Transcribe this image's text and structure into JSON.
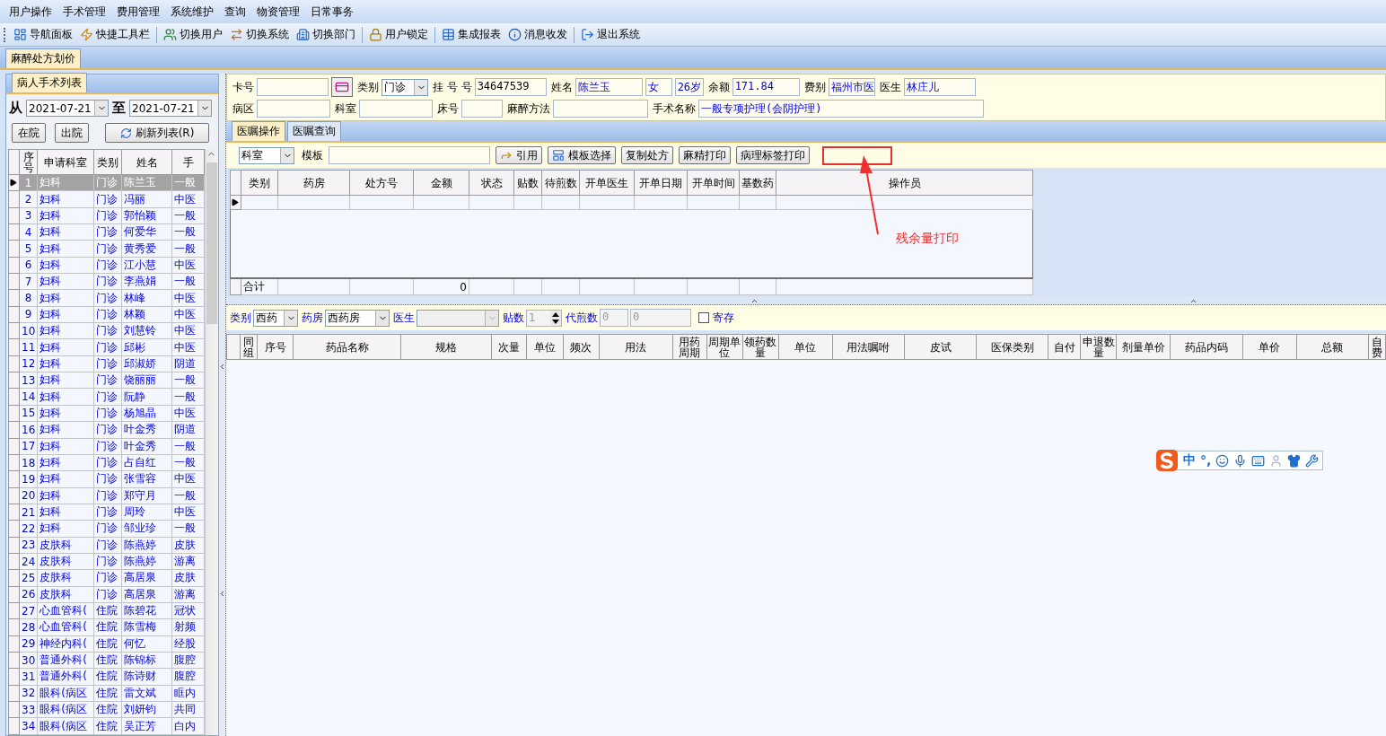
{
  "menu": [
    "用户操作",
    "手术管理",
    "费用管理",
    "系统维护",
    "查询",
    "物资管理",
    "日常事务"
  ],
  "toolbar_groups": [
    {
      "buttons": [
        {
          "label": "导航面板",
          "kind": "nav"
        },
        {
          "label": "快捷工具栏",
          "kind": "quick"
        }
      ]
    },
    {
      "buttons": [
        {
          "label": "切换用户",
          "kind": "user"
        },
        {
          "label": "切换系统",
          "kind": "system"
        },
        {
          "label": "切换部门",
          "kind": "dept"
        }
      ]
    },
    {
      "buttons": [
        {
          "label": "用户锁定",
          "kind": "lock"
        }
      ]
    },
    {
      "buttons": [
        {
          "label": "集成报表",
          "kind": "report"
        },
        {
          "label": "消息收发",
          "kind": "message"
        }
      ]
    },
    {
      "buttons": [
        {
          "label": "退出系统",
          "kind": "exit"
        }
      ]
    }
  ],
  "document_tabs": [
    {
      "label": "麻醉处方划价",
      "selected": true
    }
  ],
  "left_panel": {
    "tab": {
      "label": "病人手术列表",
      "selected": true
    },
    "from_label": "从",
    "from_date": "2021-07-21",
    "to_label": "至",
    "to_date": "2021-07-21",
    "buttons": [
      "在院",
      "出院"
    ],
    "refresh_button": "刷新列表(R)"
  },
  "patients": {
    "columns": [
      "序号",
      "申请科室",
      "类别",
      "姓名",
      "手"
    ],
    "rows": [
      {
        "cells": [
          "1",
          "妇科",
          "门诊",
          "陈兰玉",
          "一般"
        ],
        "selected": true
      },
      {
        "cells": [
          "2",
          "妇科",
          "门诊",
          "冯丽",
          "中医"
        ],
        "selected": false
      },
      {
        "cells": [
          "3",
          "妇科",
          "门诊",
          "郭怡颖",
          "一般"
        ],
        "selected": false
      },
      {
        "cells": [
          "4",
          "妇科",
          "门诊",
          "何爱华",
          "一般"
        ],
        "selected": false
      },
      {
        "cells": [
          "5",
          "妇科",
          "门诊",
          "黄秀爱",
          "一般"
        ],
        "selected": false
      },
      {
        "cells": [
          "6",
          "妇科",
          "门诊",
          "江小慧",
          "中医"
        ],
        "selected": false
      },
      {
        "cells": [
          "7",
          "妇科",
          "门诊",
          "李燕娟",
          "一般"
        ],
        "selected": false
      },
      {
        "cells": [
          "8",
          "妇科",
          "门诊",
          "林峰",
          "中医"
        ],
        "selected": false
      },
      {
        "cells": [
          "9",
          "妇科",
          "门诊",
          "林颖",
          "中医"
        ],
        "selected": false
      },
      {
        "cells": [
          "10",
          "妇科",
          "门诊",
          "刘慧铃",
          "中医"
        ],
        "selected": false
      },
      {
        "cells": [
          "11",
          "妇科",
          "门诊",
          "邱彬",
          "中医"
        ],
        "selected": false
      },
      {
        "cells": [
          "12",
          "妇科",
          "门诊",
          "邱淑娇",
          "阴道"
        ],
        "selected": false
      },
      {
        "cells": [
          "13",
          "妇科",
          "门诊",
          "饶丽丽",
          "一般"
        ],
        "selected": false
      },
      {
        "cells": [
          "14",
          "妇科",
          "门诊",
          "阮静",
          "一般"
        ],
        "selected": false
      },
      {
        "cells": [
          "15",
          "妇科",
          "门诊",
          "杨旭晶",
          "中医"
        ],
        "selected": false
      },
      {
        "cells": [
          "16",
          "妇科",
          "门诊",
          "叶金秀",
          "阴道"
        ],
        "selected": false
      },
      {
        "cells": [
          "17",
          "妇科",
          "门诊",
          "叶金秀",
          "一般"
        ],
        "selected": false
      },
      {
        "cells": [
          "18",
          "妇科",
          "门诊",
          "占自红",
          "一般"
        ],
        "selected": false
      },
      {
        "cells": [
          "19",
          "妇科",
          "门诊",
          "张雪容",
          "中医"
        ],
        "selected": false
      },
      {
        "cells": [
          "20",
          "妇科",
          "门诊",
          "郑守月",
          "一般"
        ],
        "selected": false
      },
      {
        "cells": [
          "21",
          "妇科",
          "门诊",
          "周玲",
          "中医"
        ],
        "selected": false
      },
      {
        "cells": [
          "22",
          "妇科",
          "门诊",
          "邹业珍",
          "一般"
        ],
        "selected": false
      },
      {
        "cells": [
          "23",
          "皮肤科",
          "门诊",
          "陈燕婷",
          "皮肤"
        ],
        "selected": false
      },
      {
        "cells": [
          "24",
          "皮肤科",
          "门诊",
          "陈燕婷",
          "游离"
        ],
        "selected": false
      },
      {
        "cells": [
          "25",
          "皮肤科",
          "门诊",
          "高居泉",
          "皮肤"
        ],
        "selected": false
      },
      {
        "cells": [
          "26",
          "皮肤科",
          "门诊",
          "高居泉",
          "游离"
        ],
        "selected": false
      },
      {
        "cells": [
          "27",
          "心血管科(",
          "住院",
          "陈碧花",
          "冠状"
        ],
        "selected": false
      },
      {
        "cells": [
          "28",
          "心血管科(",
          "住院",
          "陈雪梅",
          "射频"
        ],
        "selected": false
      },
      {
        "cells": [
          "29",
          "神经内科(",
          "住院",
          "何忆",
          "经股"
        ],
        "selected": false
      },
      {
        "cells": [
          "30",
          "普通外科(",
          "住院",
          "陈锦标",
          "腹腔"
        ],
        "selected": false
      },
      {
        "cells": [
          "31",
          "普通外科(",
          "住院",
          "陈诗财",
          "腹腔"
        ],
        "selected": false
      },
      {
        "cells": [
          "32",
          "眼科(病区",
          "住院",
          "雷文斌",
          "眶内"
        ],
        "selected": false
      },
      {
        "cells": [
          "33",
          "眼科(病区",
          "住院",
          "刘妍钧",
          "共同"
        ],
        "selected": false
      },
      {
        "cells": [
          "34",
          "眼科(病区",
          "住院",
          "吴正芳",
          "白内"
        ],
        "selected": false
      }
    ]
  },
  "patient_form": {
    "rows": [
      {
        "fields": [
          {
            "label": "卡号",
            "kind": "text"
          },
          {
            "kind": "card-button"
          },
          {
            "label": "类别",
            "value": "门诊",
            "kind": "select"
          },
          {
            "label": "挂 号 号",
            "value": "34647539",
            "kind": "text"
          },
          {
            "label": "姓名",
            "value": "陈兰玉",
            "kind": "info"
          },
          {
            "value": "女",
            "kind": "info"
          },
          {
            "value": "26岁",
            "kind": "info"
          },
          {
            "label": "余额",
            "value": "171.84",
            "kind": "info"
          },
          {
            "label": "费别",
            "value": "福州市医",
            "kind": "info"
          },
          {
            "label": "医生",
            "value": "林庄儿",
            "kind": "info"
          }
        ]
      },
      {
        "fields": [
          {
            "label": "病区",
            "kind": "text"
          },
          {
            "label": "科室",
            "kind": "text"
          },
          {
            "label": "床号",
            "kind": "text"
          },
          {
            "label": "麻醉方法",
            "kind": "text"
          },
          {
            "label": "手术名称",
            "value": "一般专项护理(会阴护理)",
            "kind": "info"
          }
        ]
      }
    ]
  },
  "order_tabs": [
    {
      "label": "医嘱操作",
      "selected": true
    },
    {
      "label": "医嘱查询",
      "selected": false
    }
  ],
  "order_toolbar": {
    "dept_select": "科室",
    "template_label": "模板",
    "buttons": [
      {
        "label": "引用",
        "kind": "quote"
      },
      {
        "label": "模板选择",
        "kind": "template"
      },
      {
        "label": "复制处方",
        "kind": "plain"
      },
      {
        "label": "麻精打印",
        "kind": "plain"
      },
      {
        "label": "病理标签打印",
        "kind": "plain"
      }
    ]
  },
  "annotation": {
    "label": "残余量打印"
  },
  "prescriptions": {
    "columns": [
      "类别",
      "药房",
      "处方号",
      "金额",
      "状态",
      "贴数",
      "待煎数",
      "开单医生",
      "开单日期",
      "开单时间",
      "基数药",
      "操作员"
    ],
    "footer_label": "合计",
    "footer_amount": "0"
  },
  "drug_filter": {
    "category_label": "类别",
    "category": "西药",
    "pharmacy_label": "药房",
    "pharmacy": "西药房",
    "doctor_label": "医生",
    "doctor_disabled": true,
    "doses_label": "贴数",
    "doses": "1",
    "decoct_label": "代煎数",
    "decoct": "0",
    "decoct_2": "0",
    "deposit_label": "寄存",
    "deposit_checked": false
  },
  "drugs": {
    "columns": [
      "同组",
      "序号",
      "药品名称",
      "规格",
      "次量",
      "单位",
      "频次",
      "用法",
      "用药周期",
      "周期单位",
      "领药数量",
      "单位",
      "用法嘱咐",
      "皮试",
      "医保类别",
      "自付",
      "申退数量",
      "剂量单价",
      "药品内码",
      "单价",
      "总额",
      "自费"
    ]
  },
  "ime_toolbar": {
    "mode": "中",
    "punctuation": "°,"
  }
}
